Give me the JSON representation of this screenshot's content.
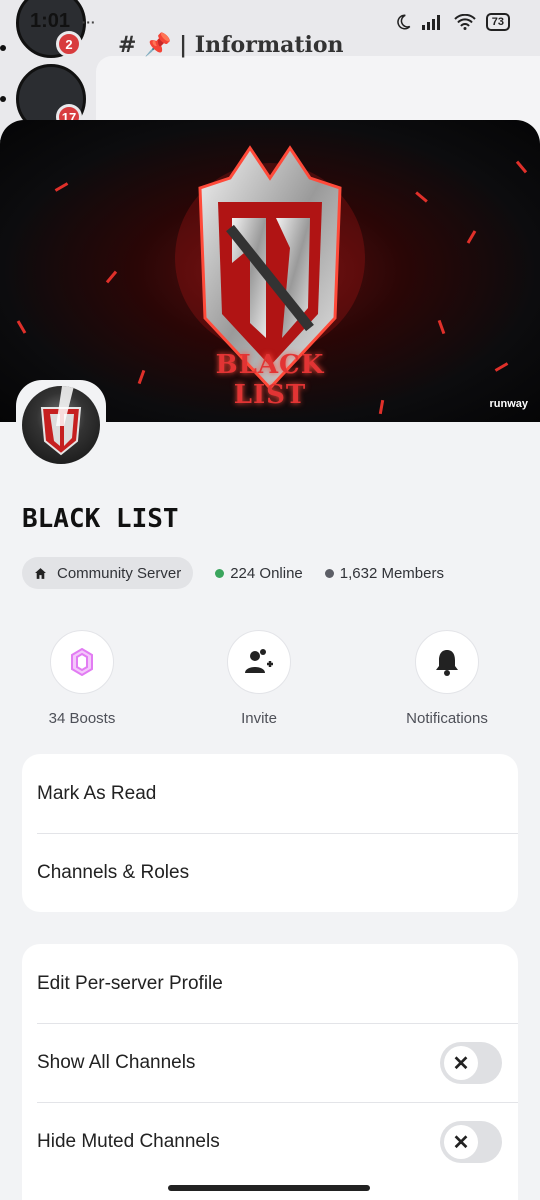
{
  "status_bar": {
    "time": "1:01",
    "more": "···",
    "battery": "73"
  },
  "background": {
    "channel_name": "# 📌 | Information",
    "server_badges": [
      "2",
      "17"
    ]
  },
  "server": {
    "name": "BLACK LIST",
    "type": "Community Server",
    "online": "224 Online",
    "members": "1,632 Members",
    "banner_watermark": "runway",
    "banner_logo_text": "BLACK LIST"
  },
  "actions": [
    {
      "label": "34 Boosts",
      "icon": "boost-gem-icon"
    },
    {
      "label": "Invite",
      "icon": "add-user-icon"
    },
    {
      "label": "Notifications",
      "icon": "bell-icon"
    }
  ],
  "menu_group_1": [
    {
      "label": "Mark As Read"
    },
    {
      "label": "Channels & Roles"
    }
  ],
  "menu_group_2": [
    {
      "label": "Edit Per-server Profile"
    },
    {
      "label": "Show All Channels",
      "toggle": false
    },
    {
      "label": "Hide Muted Channels",
      "toggle": false
    }
  ],
  "colors": {
    "online": "#3ba55d",
    "members": "#5c5e66",
    "boost": "#e27cf3",
    "sheet_bg": "#f2f3f5",
    "accent_red": "#e0302a"
  }
}
